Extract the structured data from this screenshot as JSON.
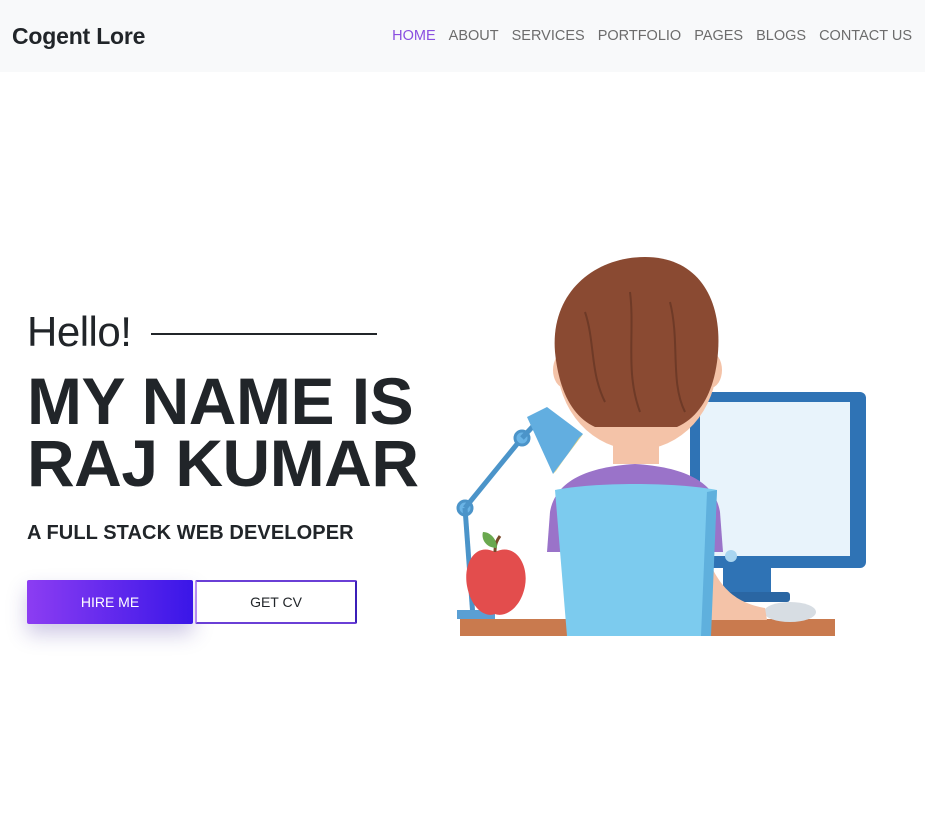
{
  "brand": {
    "name": "Cogent Lore"
  },
  "nav": {
    "items": [
      {
        "label": "HOME",
        "active": true
      },
      {
        "label": "ABOUT",
        "active": false
      },
      {
        "label": "SERVICES",
        "active": false
      },
      {
        "label": "PORTFOLIO",
        "active": false
      },
      {
        "label": "PAGES",
        "active": false
      },
      {
        "label": "BLOGS",
        "active": false
      },
      {
        "label": "CONTACT US",
        "active": false
      }
    ],
    "active_color": "#8a4fe0"
  },
  "hero": {
    "greeting": "Hello!",
    "name_line1": "MY NAME IS",
    "name_line2": "RAJ KUMAR",
    "subtitle": "A FULL STACK WEB DEVELOPER",
    "hire_button": "HIRE ME",
    "cv_button": "GET CV",
    "illustration": "developer-at-computer-illustration"
  },
  "colors": {
    "navbar_bg": "#f8f9fa",
    "gradient_start": "#8c3df2",
    "gradient_end": "#3a16e8"
  }
}
